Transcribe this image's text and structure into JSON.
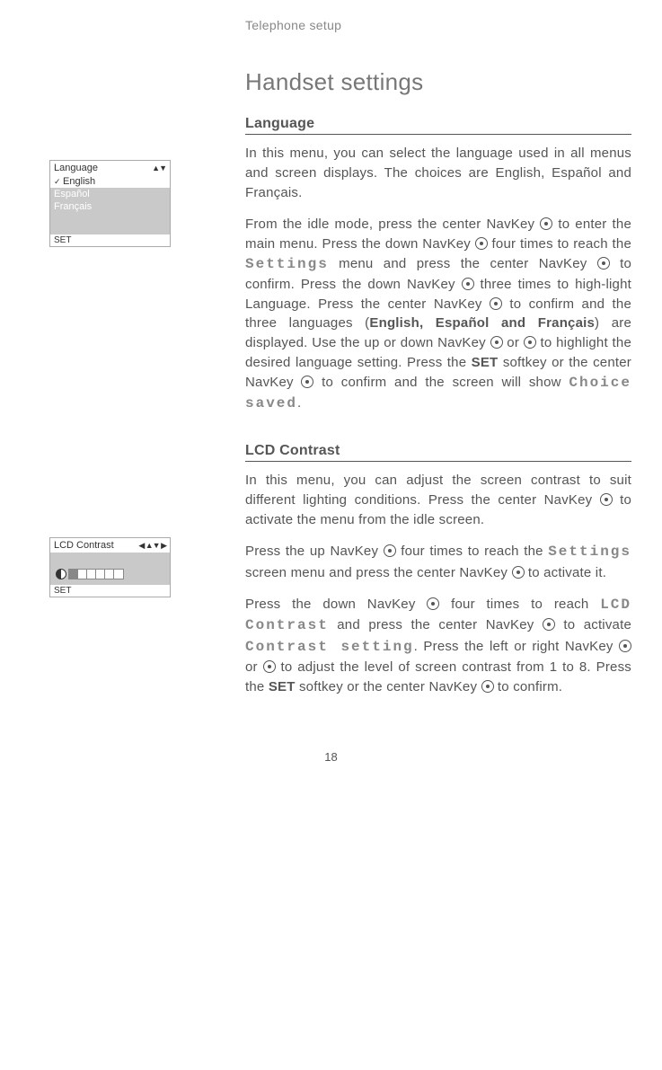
{
  "running_head": "Telephone setup",
  "title": "Handset settings",
  "page_number": "18",
  "side1": {
    "title": "Language",
    "arrows": "▲▼",
    "items": [
      "English",
      "Español",
      "Français"
    ],
    "footer": "SET"
  },
  "side2": {
    "title": "LCD Contrast",
    "arrows": "◀ ▲▼ ▶",
    "footer": "SET"
  },
  "sec1": {
    "heading": "Language",
    "p1": "In this menu, you can select the language used in all menus and screen displays. The choices are English, Español and Français.",
    "p2a": "From the idle mode, press the center NavKey ",
    "p2b": " to enter the main menu. Press the down NavKey ",
    "p2c": " four times to reach the ",
    "p2_menu": "Settings",
    "p2d": " menu and press the center NavKey ",
    "p2e": " to confirm. Press the down NavKey ",
    "p2f": " three times to high-light Language. Press the center NavKey ",
    "p2g": " to confirm and the three languages (",
    "p2_bold": "English, Español and Français",
    "p2h": ") are displayed. Use the up or down NavKey ",
    "p2i": " or ",
    "p2j": " to highlight the desired language setting. Press the ",
    "p2_set": "SET",
    "p2k": " softkey or the center NavKey ",
    "p2l": " to confirm and the screen will show ",
    "p2_saved": "Choice saved",
    "p2m": "."
  },
  "sec2": {
    "heading": "LCD Contrast",
    "p1a": "In this menu, you can adjust the screen contrast to suit different lighting conditions. Press the center NavKey ",
    "p1b": " to activate the menu from the idle screen.",
    "p2a": "Press the up NavKey ",
    "p2b": " four times to reach the ",
    "p2_menu": "Settings",
    "p2c": " screen menu and press the center NavKey ",
    "p2d": " to activate it.",
    "p3a": "Press the down NavKey ",
    "p3b": " four times to reach ",
    "p3_lcd": "LCD Contrast",
    "p3c": " and press the center NavKey ",
    "p3d": " to activate ",
    "p3_cs": "Contrast setting",
    "p3e": ". Press the left or right NavKey ",
    "p3f": " or ",
    "p3g": " to adjust the level of screen contrast from 1 to 8. Press the ",
    "p3_set": "SET",
    "p3h": " softkey or the center NavKey ",
    "p3i": " to confirm."
  }
}
